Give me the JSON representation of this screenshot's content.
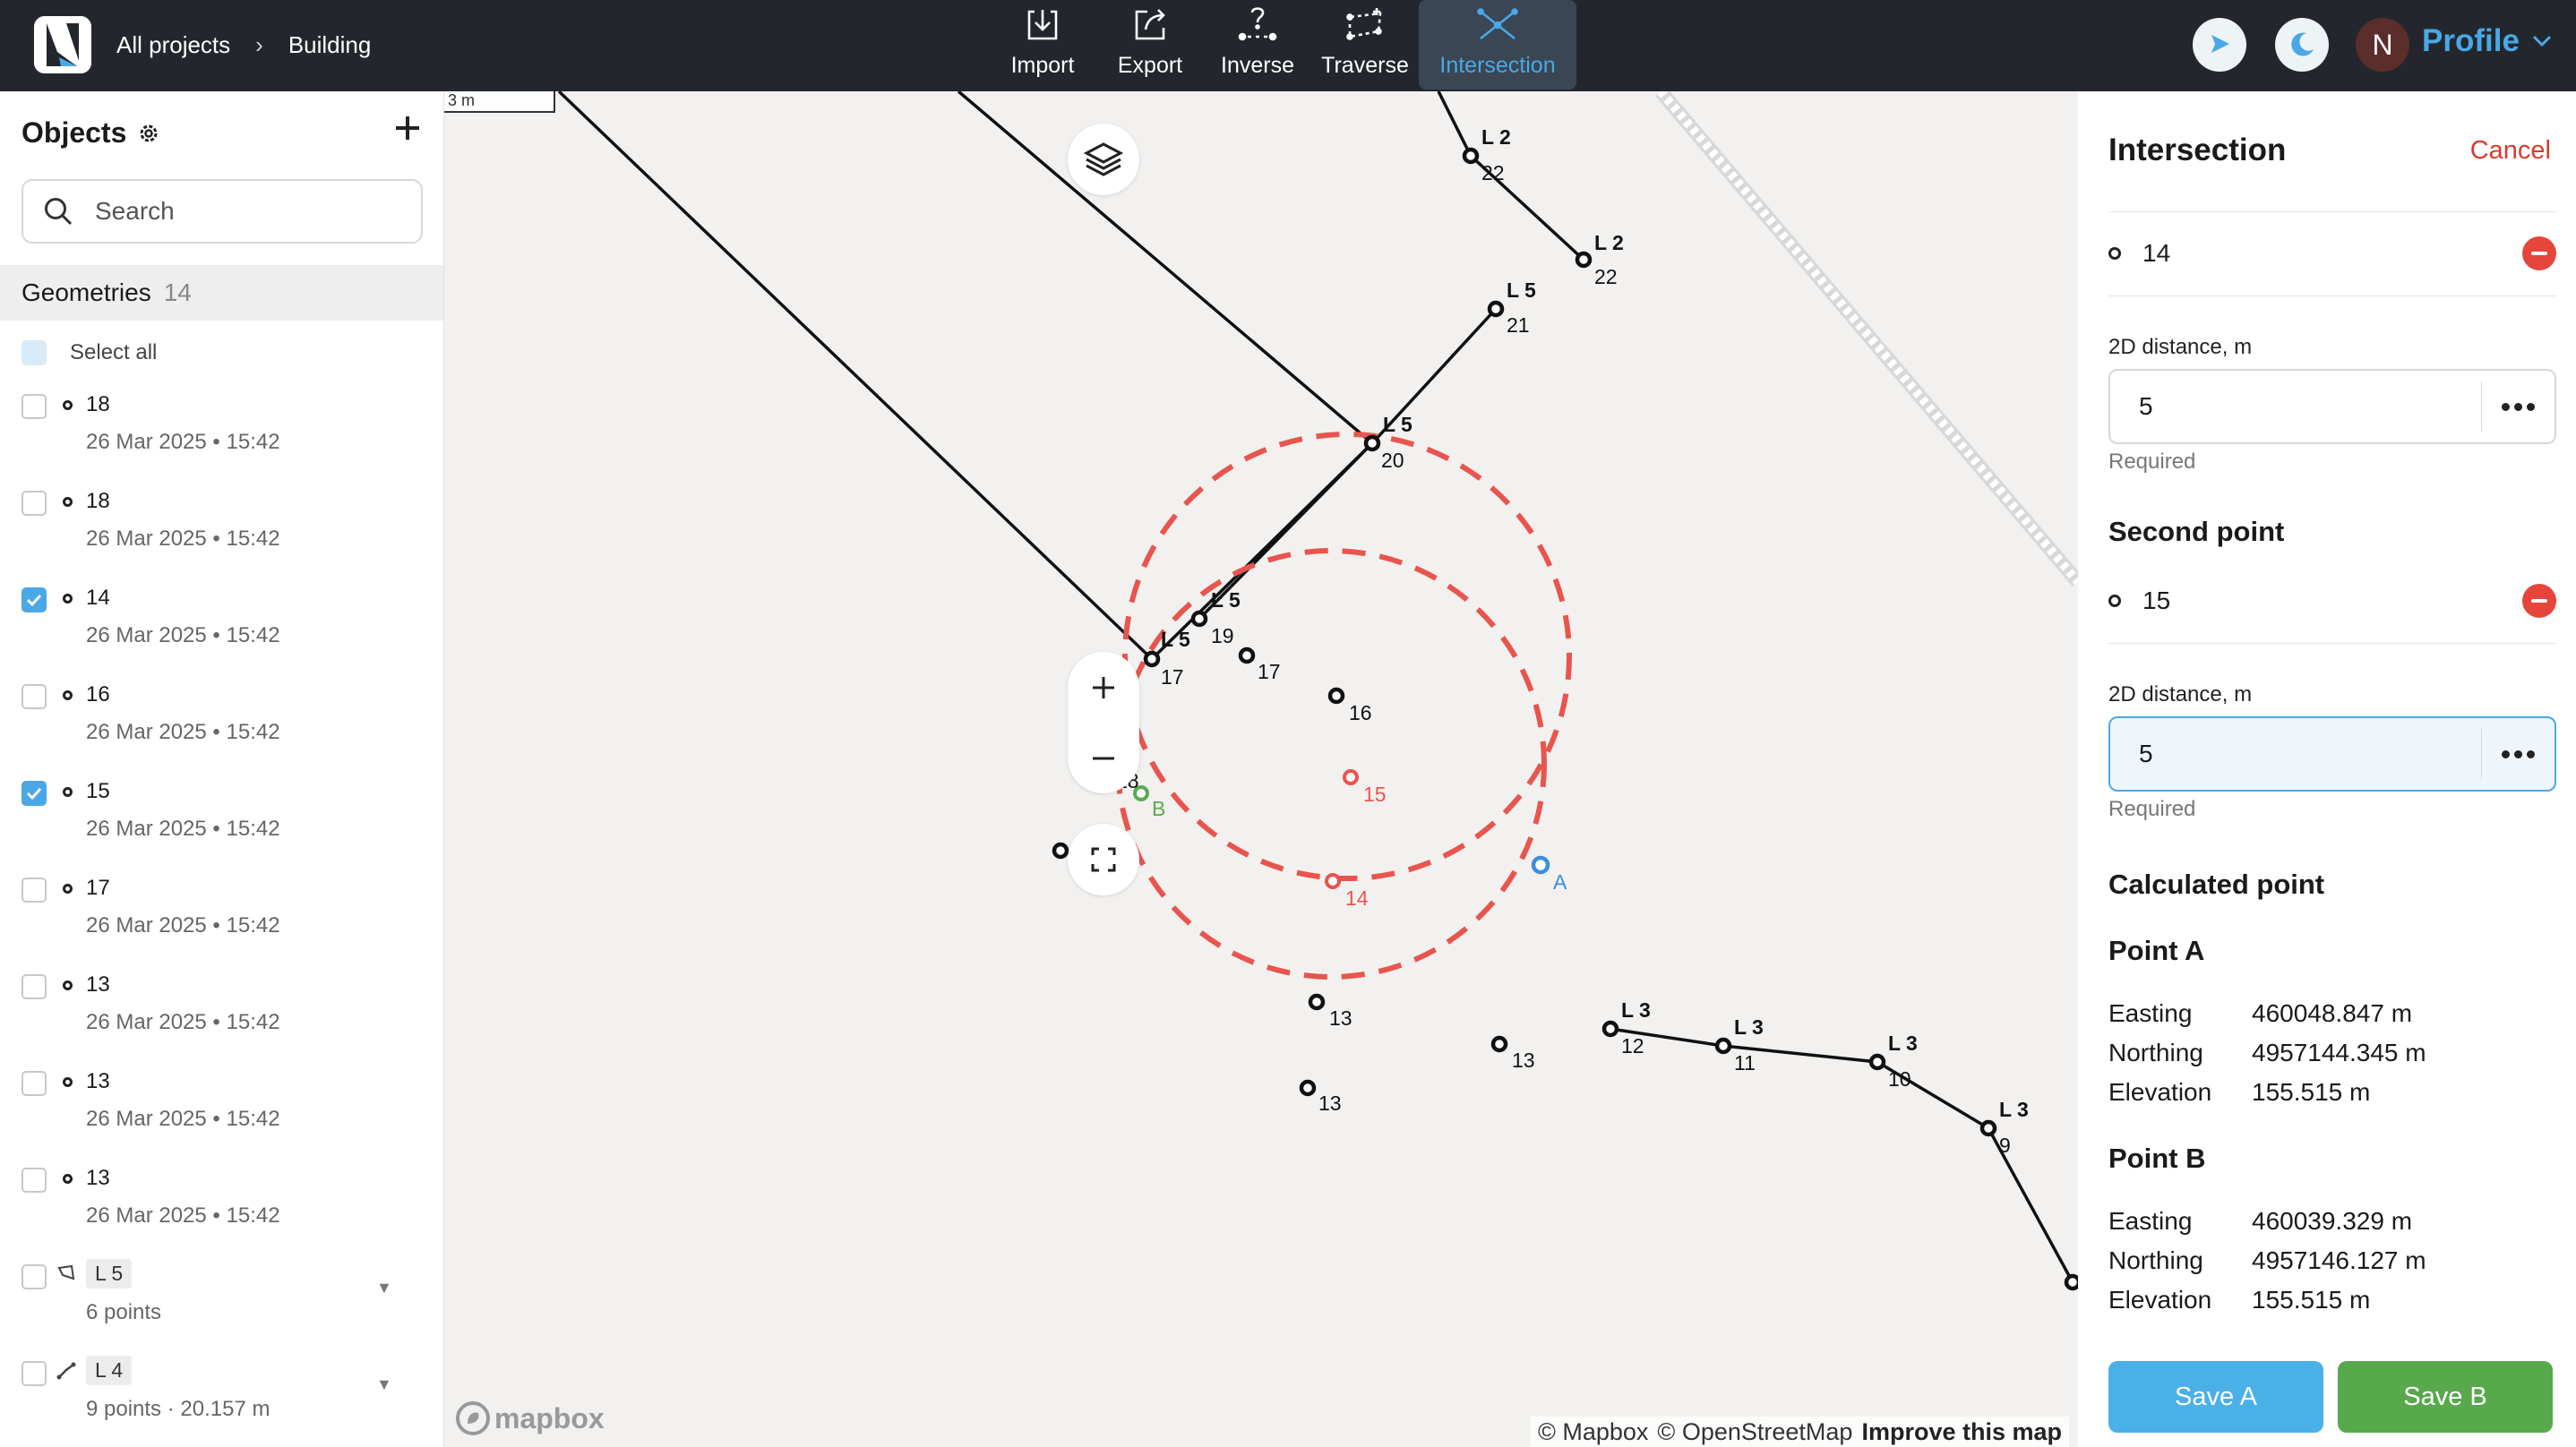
{
  "colors": {
    "accent": "#4aa8e6",
    "danger": "#e5453a",
    "save_a": "#4ab0e8",
    "save_b": "#58a84c",
    "circle": "#e8554e",
    "point_a": "#3a8ee0",
    "point_b": "#5aab4e"
  },
  "header": {
    "breadcrumb": [
      "All projects",
      "Building"
    ],
    "tools": [
      {
        "label": "Import",
        "icon": "import-icon"
      },
      {
        "label": "Export",
        "icon": "export-icon"
      },
      {
        "label": "Inverse",
        "icon": "inverse-icon"
      },
      {
        "label": "Traverse",
        "icon": "traverse-icon"
      },
      {
        "label": "Intersection",
        "icon": "intersection-icon",
        "active": true
      }
    ],
    "avatar_initial": "N",
    "profile_label": "Profile"
  },
  "sidebar": {
    "title": "Objects",
    "search_placeholder": "Search",
    "geometries_label": "Geometries",
    "geometries_count": "14",
    "select_all": "Select all",
    "items": [
      {
        "name": "18",
        "date": "26 Mar 2025 • 15:42",
        "checked": false,
        "kind": "point"
      },
      {
        "name": "18",
        "date": "26 Mar 2025 • 15:42",
        "checked": false,
        "kind": "point"
      },
      {
        "name": "14",
        "date": "26 Mar 2025 • 15:42",
        "checked": true,
        "kind": "point"
      },
      {
        "name": "16",
        "date": "26 Mar 2025 • 15:42",
        "checked": false,
        "kind": "point"
      },
      {
        "name": "15",
        "date": "26 Mar 2025 • 15:42",
        "checked": true,
        "kind": "point"
      },
      {
        "name": "17",
        "date": "26 Mar 2025 • 15:42",
        "checked": false,
        "kind": "point"
      },
      {
        "name": "13",
        "date": "26 Mar 2025 • 15:42",
        "checked": false,
        "kind": "point"
      },
      {
        "name": "13",
        "date": "26 Mar 2025 • 15:42",
        "checked": false,
        "kind": "point"
      },
      {
        "name": "13",
        "date": "26 Mar 2025 • 15:42",
        "checked": false,
        "kind": "point"
      },
      {
        "name": "L 5",
        "date": "6 points",
        "checked": false,
        "kind": "polygon"
      },
      {
        "name": "L 4",
        "date": "9 points · 20.157 m",
        "checked": false,
        "kind": "line"
      }
    ]
  },
  "map": {
    "scale_label": "3 m",
    "attribution": [
      "© Mapbox",
      "© OpenStreetMap",
      "Improve this map"
    ],
    "logo_text": "mapbox",
    "labels": {
      "l2a": "L 2",
      "n22a": "22",
      "l2b": "L 2",
      "n22b": "22",
      "l5a": "L 5",
      "n21": "21",
      "l5b": "L 5",
      "n20": "20",
      "l5c": "L 5",
      "n19": "19",
      "l5d": "L 5",
      "n17a": "17",
      "n17b": "17",
      "n16": "16",
      "n18a": "18",
      "n18b": "18",
      "b": "B",
      "n15": "15",
      "n14": "14",
      "a": "A",
      "n13a": "13",
      "n13b": "13",
      "n13c": "13",
      "l3a": "L 3",
      "n12": "12",
      "l3b": "L 3",
      "n11": "11",
      "l3c": "L 3",
      "n10": "10",
      "l3d": "L 3",
      "n9": "9"
    }
  },
  "panel": {
    "title": "Intersection",
    "cancel": "Cancel",
    "first_point": "14",
    "dist_label_1": "2D distance, m",
    "dist_value_1": "5",
    "required_1": "Required",
    "second_point_title": "Second point",
    "second_point": "15",
    "dist_label_2": "2D distance, m",
    "dist_value_2": "5",
    "required_2": "Required",
    "calculated_title": "Calculated point",
    "point_a": {
      "title": "Point A",
      "easting_label": "Easting",
      "easting": "460048.847 m",
      "northing_label": "Northing",
      "northing": "4957144.345 m",
      "elevation_label": "Elevation",
      "elevation": "155.515 m"
    },
    "point_b": {
      "title": "Point B",
      "easting_label": "Easting",
      "easting": "460039.329 m",
      "northing_label": "Northing",
      "northing": "4957146.127 m",
      "elevation_label": "Elevation",
      "elevation": "155.515 m"
    },
    "save_a": "Save A",
    "save_b": "Save B"
  }
}
